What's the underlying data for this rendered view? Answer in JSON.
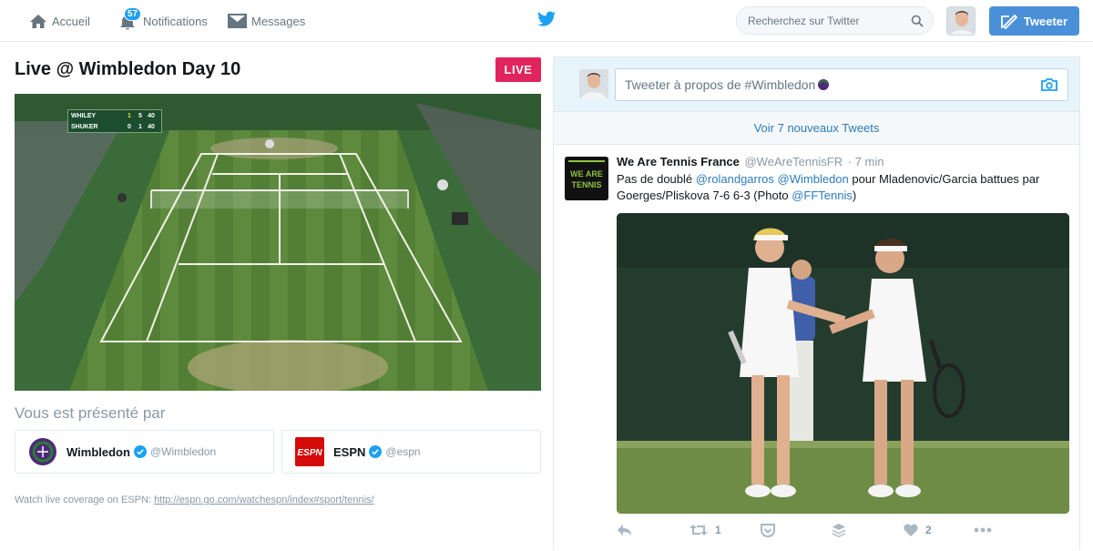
{
  "nav": {
    "home_label": "Accueil",
    "notifications_label": "Notifications",
    "notifications_count": "57",
    "messages_label": "Messages",
    "search_placeholder": "Recherchez sur Twitter",
    "tweet_button_label": "Tweeter"
  },
  "event": {
    "title": "Live @ Wimbledon Day 10",
    "live_label": "LIVE"
  },
  "scoreboard": {
    "rows": [
      {
        "name": "WHILEY",
        "s1": "1",
        "s2": "5",
        "s3": "40"
      },
      {
        "name": "SHUKER",
        "s1": "0",
        "s2": "1",
        "s3": "40"
      }
    ]
  },
  "sponsors": {
    "heading": "Vous est présenté par",
    "items": [
      {
        "name": "Wimbledon",
        "handle": "@Wimbledon"
      },
      {
        "name": "ESPN",
        "handle": "@espn",
        "logo_text": "ESPN"
      }
    ]
  },
  "watch": {
    "prefix": "Watch live coverage on ESPN: ",
    "url": "http://espn.go.com/watchespn/index#sport/tennis/"
  },
  "compose": {
    "placeholder_prefix": "Tweeter à propos de ",
    "hashtag": "#Wimbledon"
  },
  "stream": {
    "new_tweets_label": "Voir 7 nouveaux Tweets"
  },
  "tweet": {
    "author_name": "We Are Tennis France",
    "author_handle": "@WeAreTennisFR",
    "time": "· 7 min",
    "avatar_line1": "WE ARE",
    "avatar_line2": "TENNIS",
    "text_1": "Pas de doublé ",
    "mention_1": "@rolandgarros",
    "text_2": " ",
    "mention_2": "@Wimbledon",
    "text_3": " pour Mladenovic/Garcia battues par Goerges/Pliskova 7-6 6-3 (Photo ",
    "mention_3": "@FFTennis",
    "text_4": ")",
    "retweet_count": "1",
    "like_count": "2"
  },
  "colors": {
    "accent": "#1da1f2",
    "live": "#e0245e",
    "tweet_button": "#4a90d9"
  }
}
